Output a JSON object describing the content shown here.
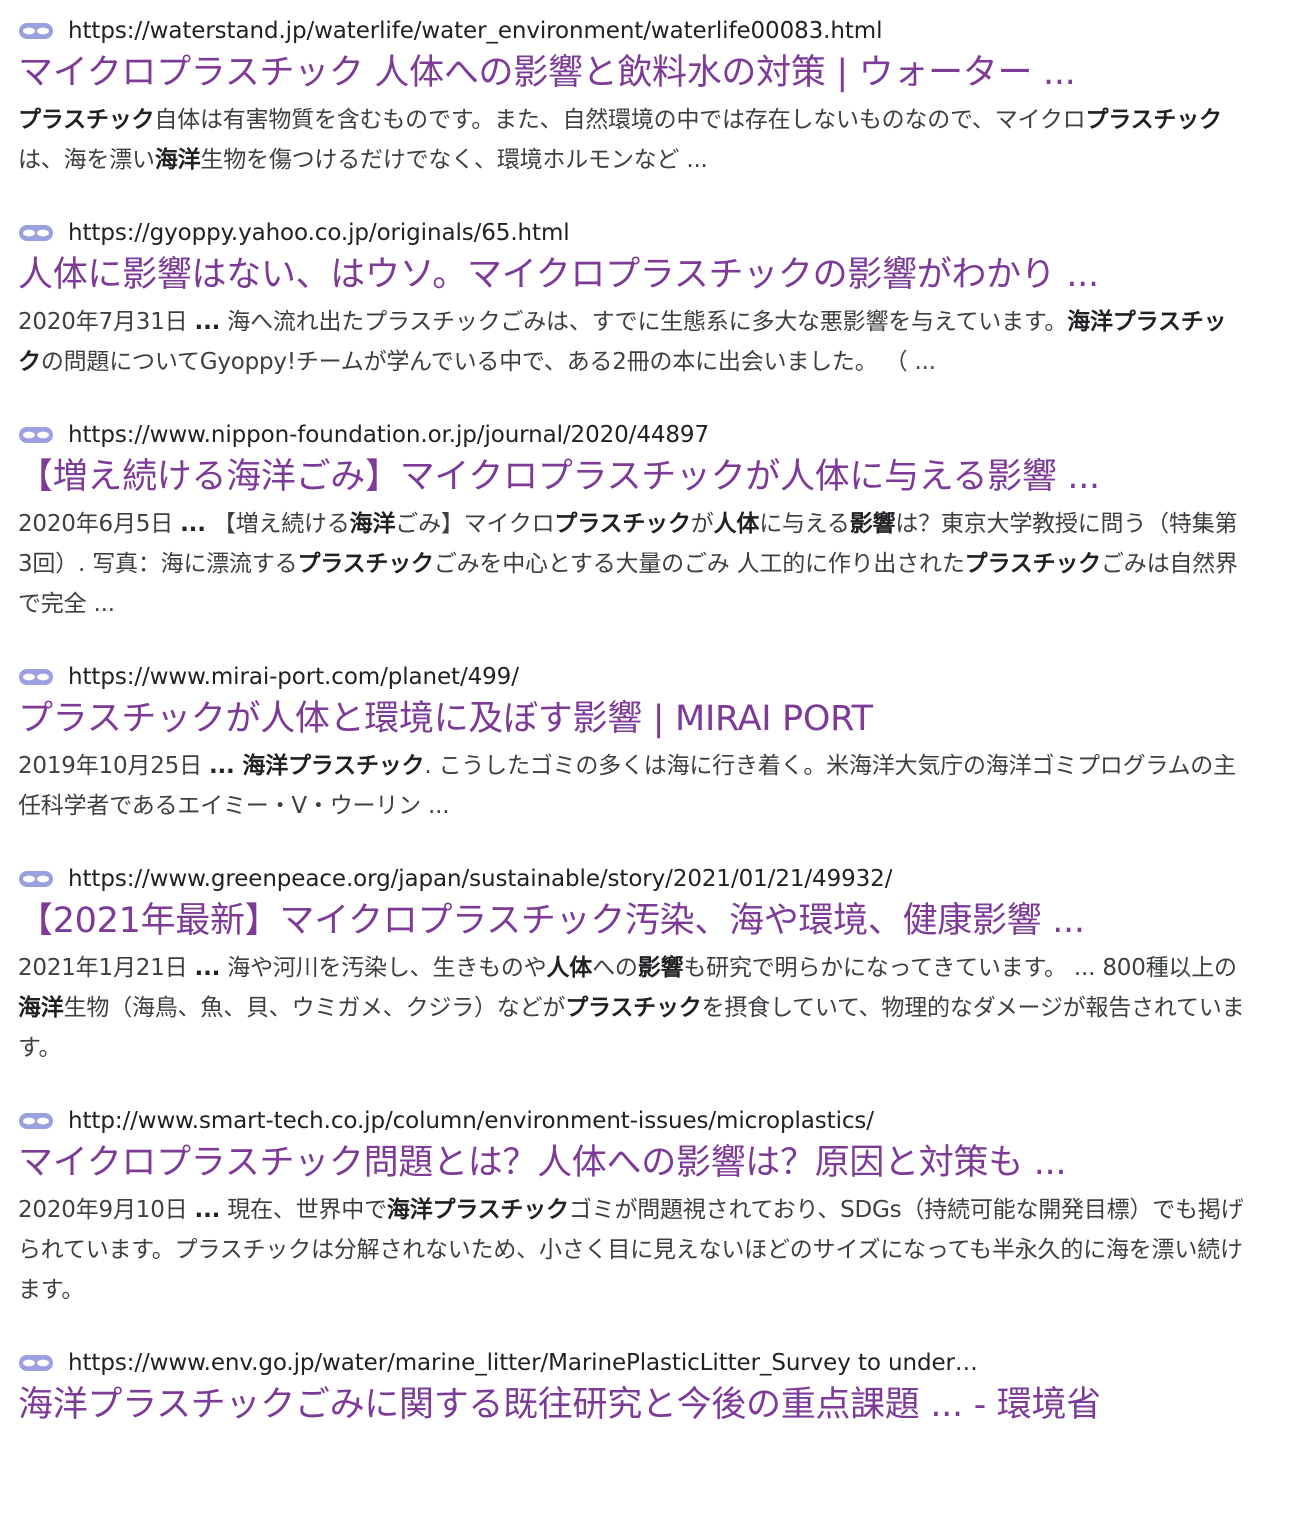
{
  "results": [
    {
      "url": "https://waterstand.jp/waterlife/water_environment/waterlife00083.html",
      "title": "マイクロプラスチック 人体への影響と飲料水の対策 | ウォーター ...",
      "snippet": [
        {
          "b": true,
          "t": "プラスチック"
        },
        {
          "b": false,
          "t": "自体は有害物質を含むものです。また、自然環境の中では存在しないものなので、マイクロ"
        },
        {
          "b": true,
          "t": "プラスチック"
        },
        {
          "b": false,
          "t": "は、海を漂い"
        },
        {
          "b": true,
          "t": "海洋"
        },
        {
          "b": false,
          "t": "生物を傷つけるだけでなく、環境ホルモンなど ..."
        }
      ]
    },
    {
      "url": "https://gyoppy.yahoo.co.jp/originals/65.html",
      "title": "人体に影響はない、はウソ。マイクロプラスチックの影響がわかり ...",
      "snippet": [
        {
          "b": false,
          "t": "2020年7月31日 "
        },
        {
          "b": true,
          "t": "..."
        },
        {
          "b": false,
          "t": " 海へ流れ出たプラスチックごみは、すでに生態系に多大な悪影響を与えています。"
        },
        {
          "b": true,
          "t": "海洋プラスチック"
        },
        {
          "b": false,
          "t": "の問題についてGyoppy!チームが学んでいる中で、ある2冊の本に出会いました。 （ ..."
        }
      ]
    },
    {
      "url": "https://www.nippon-foundation.or.jp/journal/2020/44897",
      "title": "【増え続ける海洋ごみ】マイクロプラスチックが人体に与える影響 ...",
      "snippet": [
        {
          "b": false,
          "t": "2020年6月5日 "
        },
        {
          "b": true,
          "t": "..."
        },
        {
          "b": false,
          "t": " 【増え続ける"
        },
        {
          "b": true,
          "t": "海洋"
        },
        {
          "b": false,
          "t": "ごみ】マイクロ"
        },
        {
          "b": true,
          "t": "プラスチック"
        },
        {
          "b": false,
          "t": "が"
        },
        {
          "b": true,
          "t": "人体"
        },
        {
          "b": false,
          "t": "に与える"
        },
        {
          "b": true,
          "t": "影響"
        },
        {
          "b": false,
          "t": "は？東京大学教授に問う（特集第3回）. 写真：海に漂流する"
        },
        {
          "b": true,
          "t": "プラスチック"
        },
        {
          "b": false,
          "t": "ごみを中心とする大量のごみ 人工的に作り出された"
        },
        {
          "b": true,
          "t": "プラスチック"
        },
        {
          "b": false,
          "t": "ごみは自然界で完全 ..."
        }
      ]
    },
    {
      "url": "https://www.mirai-port.com/planet/499/",
      "title": "プラスチックが人体と環境に及ぼす影響 | MIRAI PORT",
      "snippet": [
        {
          "b": false,
          "t": "2019年10月25日 "
        },
        {
          "b": true,
          "t": "... 海洋プラスチック"
        },
        {
          "b": false,
          "t": ". こうしたゴミの多くは海に行き着く。米海洋大気庁の海洋ゴミプログラムの主任科学者であるエイミー・V・ウーリン ..."
        }
      ]
    },
    {
      "url": "https://www.greenpeace.org/japan/sustainable/story/2021/01/21/49932/",
      "title": "【2021年最新】マイクロプラスチック汚染、海や環境、健康影響 ...",
      "snippet": [
        {
          "b": false,
          "t": "2021年1月21日 "
        },
        {
          "b": true,
          "t": "..."
        },
        {
          "b": false,
          "t": " 海や河川を汚染し、生きものや"
        },
        {
          "b": true,
          "t": "人体"
        },
        {
          "b": false,
          "t": "への"
        },
        {
          "b": true,
          "t": "影響"
        },
        {
          "b": false,
          "t": "も研究で明らかになってきています。 ... 800種以上の"
        },
        {
          "b": true,
          "t": "海洋"
        },
        {
          "b": false,
          "t": "生物（海鳥、魚、貝、ウミガメ、クジラ）などが"
        },
        {
          "b": true,
          "t": "プラスチック"
        },
        {
          "b": false,
          "t": "を摂食していて、物理的なダメージが報告されています。"
        }
      ]
    },
    {
      "url": "http://www.smart-tech.co.jp/column/environment-issues/microplastics/",
      "title": "マイクロプラスチック問題とは？人体への影響は？原因と対策も ...",
      "snippet": [
        {
          "b": false,
          "t": "2020年9月10日 "
        },
        {
          "b": true,
          "t": "..."
        },
        {
          "b": false,
          "t": " 現在、世界中で"
        },
        {
          "b": true,
          "t": "海洋プラスチック"
        },
        {
          "b": false,
          "t": "ゴミが問題視されており、SDGs（持続可能な開発目標）でも掲げられています。プラスチックは分解されないため、小さく目に見えないほどのサイズになっても半永久的に海を漂い続けます。"
        }
      ]
    },
    {
      "url": "https://www.env.go.jp/water/marine_litter/MarinePlasticLitter_Survey to under…",
      "title": "海洋プラスチックごみに関する既往研究と今後の重点課題 ... - 環境省",
      "snippet": []
    }
  ],
  "icons": {
    "favicon": "mask-icon",
    "favicon_color": "#9aa0e0"
  },
  "colors": {
    "title": "#7d3a97",
    "url": "#202124",
    "snippet": "#3c4043"
  }
}
